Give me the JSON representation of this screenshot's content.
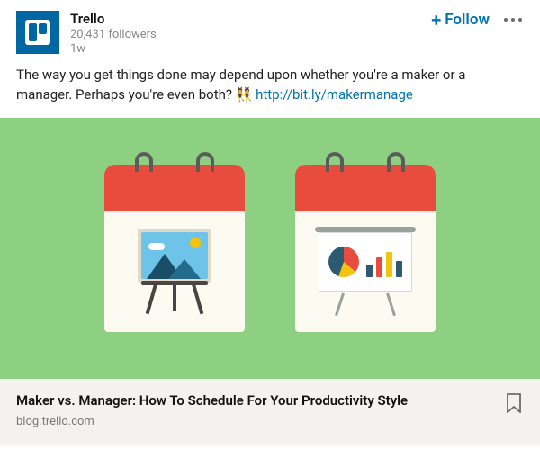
{
  "colors": {
    "brand_blue": "#0067a2",
    "link_blue": "#0073b1",
    "preview_bg": "#8ed081",
    "footer_bg": "#f3f2ef"
  },
  "author": {
    "name": "Trello",
    "followers_text": "20,431 followers",
    "age_text": "1w"
  },
  "follow_label": "Follow",
  "post": {
    "text": "The way you get things done may depend upon whether you're a maker or a manager. Perhaps you're even both?",
    "emoji": "👯",
    "link_text": "http://bit.ly/makermanage"
  },
  "preview": {
    "title": "Maker vs. Manager: How To Schedule For Your Productivity Style",
    "domain": "blog.trello.com"
  }
}
